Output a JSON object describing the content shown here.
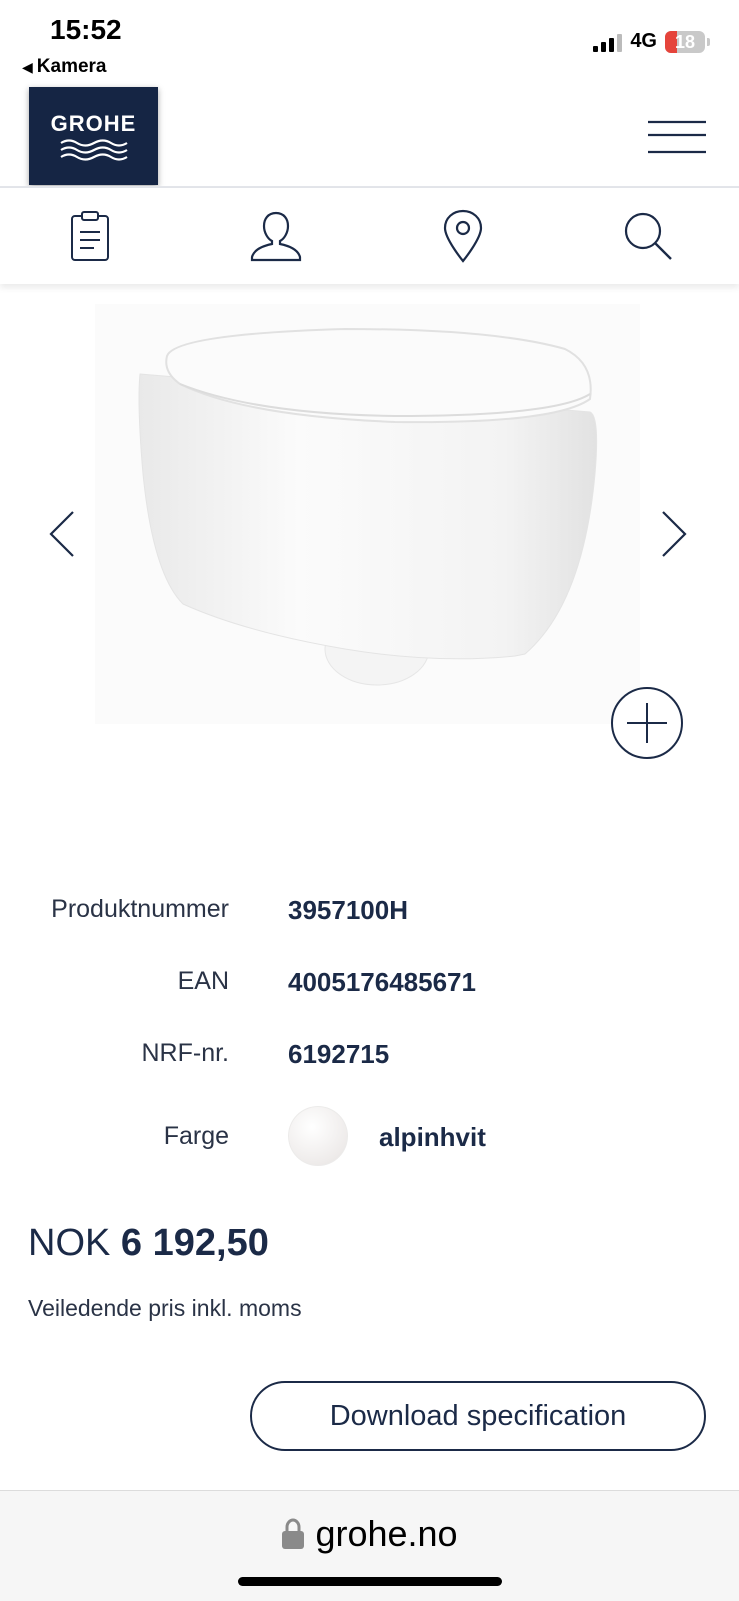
{
  "status_bar": {
    "time": "15:52",
    "back_app": "Kamera",
    "network": "4G",
    "battery_level": "18"
  },
  "header": {
    "logo_text": "GROHE",
    "menu_icon": "hamburger-menu-icon"
  },
  "icon_nav": {
    "items": [
      {
        "icon": "clipboard-icon"
      },
      {
        "icon": "user-icon"
      },
      {
        "icon": "location-pin-icon"
      },
      {
        "icon": "search-icon"
      }
    ]
  },
  "gallery": {
    "prev_icon": "chevron-left-icon",
    "next_icon": "chevron-right-icon",
    "zoom_icon": "plus-circle-icon"
  },
  "specs": {
    "product_number": {
      "label": "Produktnummer",
      "value": "3957100H"
    },
    "ean": {
      "label": "EAN",
      "value": "4005176485671"
    },
    "nrf": {
      "label": "NRF-nr.",
      "value": "6192715"
    },
    "color": {
      "label": "Farge",
      "value": "alpinhvit",
      "swatch": "#f1efee"
    }
  },
  "price": {
    "currency": "NOK",
    "amount": "6 192,50",
    "note": "Veiledende pris inkl. moms"
  },
  "download_button": "Download specification",
  "browser": {
    "url": "grohe.no",
    "lock_icon": "lock-icon"
  },
  "colors": {
    "brand_navy": "#152544",
    "text_dark": "#1b2a47"
  }
}
